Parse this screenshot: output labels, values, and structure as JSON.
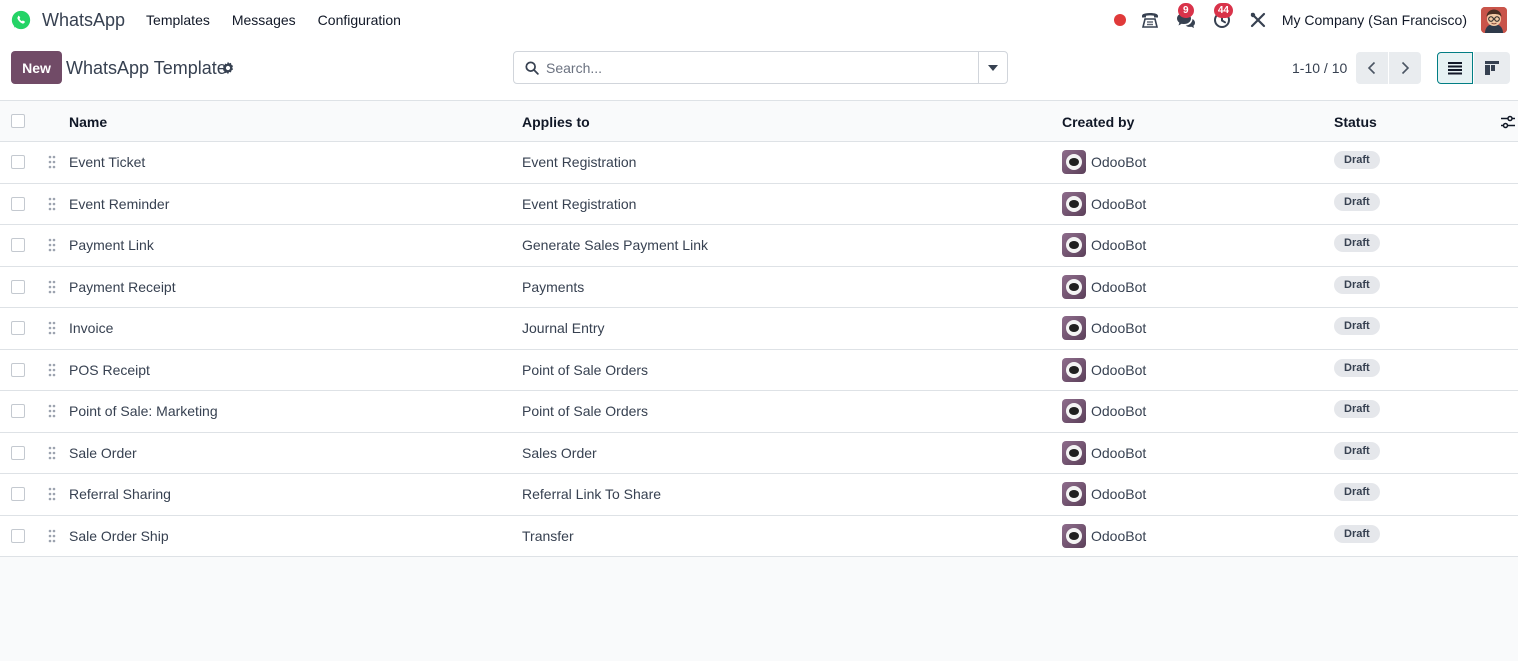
{
  "navbar": {
    "app_name": "WhatsApp",
    "menu": [
      "Templates",
      "Messages",
      "Configuration"
    ],
    "messages_count": "9",
    "activities_count": "44",
    "company": "My Company (San Francisco)",
    "icons": [
      "whatsapp-logo-icon",
      "recording-dot-icon",
      "phone-icon",
      "chat-icon",
      "clock-icon",
      "debug-tools-icon",
      "user-avatar"
    ],
    "colors": {
      "brand_green": "#25d366",
      "badge_red": "#d9334a",
      "recording_red": "#e03a3a"
    }
  },
  "control": {
    "new_label": "New",
    "title": "WhatsApp Template",
    "search_placeholder": "Search...",
    "pager": "1-10 / 10",
    "colors": {
      "primary": "#714b67",
      "active_view": "#017e84"
    }
  },
  "table": {
    "headers": {
      "name": "Name",
      "applies_to": "Applies to",
      "created_by": "Created by",
      "status": "Status"
    },
    "rows": [
      {
        "name": "Event Ticket",
        "applies_to": "Event Registration",
        "created_by": "OdooBot",
        "status": "Draft"
      },
      {
        "name": "Event Reminder",
        "applies_to": "Event Registration",
        "created_by": "OdooBot",
        "status": "Draft"
      },
      {
        "name": "Payment Link",
        "applies_to": "Generate Sales Payment Link",
        "created_by": "OdooBot",
        "status": "Draft"
      },
      {
        "name": "Payment Receipt",
        "applies_to": "Payments",
        "created_by": "OdooBot",
        "status": "Draft"
      },
      {
        "name": "Invoice",
        "applies_to": "Journal Entry",
        "created_by": "OdooBot",
        "status": "Draft"
      },
      {
        "name": "POS Receipt",
        "applies_to": "Point of Sale Orders",
        "created_by": "OdooBot",
        "status": "Draft"
      },
      {
        "name": "Point of Sale: Marketing",
        "applies_to": "Point of Sale Orders",
        "created_by": "OdooBot",
        "status": "Draft"
      },
      {
        "name": "Sale Order",
        "applies_to": "Sales Order",
        "created_by": "OdooBot",
        "status": "Draft"
      },
      {
        "name": "Referral Sharing",
        "applies_to": "Referral Link To Share",
        "created_by": "OdooBot",
        "status": "Draft"
      },
      {
        "name": "Sale Order Ship",
        "applies_to": "Transfer",
        "created_by": "OdooBot",
        "status": "Draft"
      }
    ]
  }
}
